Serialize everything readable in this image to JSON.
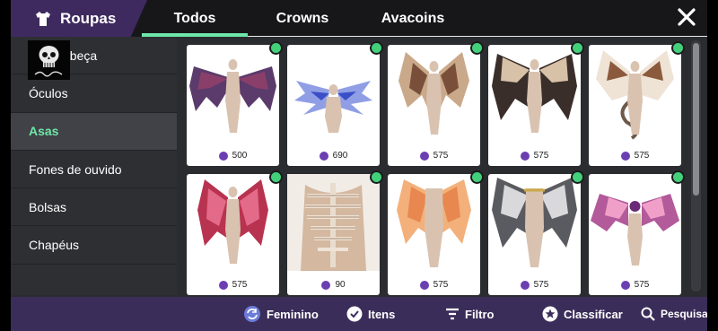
{
  "header": {
    "title": "Roupas",
    "tabs": [
      {
        "label": "Todos",
        "active": true
      },
      {
        "label": "Crowns",
        "active": false
      },
      {
        "label": "Avacoins",
        "active": false
      }
    ]
  },
  "sidebar": {
    "items": [
      {
        "label": "abeça"
      },
      {
        "label": "Óculos"
      },
      {
        "label": "Asas",
        "active": true
      },
      {
        "label": "Fones de ouvido"
      },
      {
        "label": "Bolsas"
      },
      {
        "label": "Chapéus"
      },
      {
        "label": ""
      }
    ]
  },
  "items": [
    {
      "price": "500",
      "owned": true
    },
    {
      "price": "690",
      "owned": true
    },
    {
      "price": "575",
      "owned": true
    },
    {
      "price": "575",
      "owned": true
    },
    {
      "price": "575",
      "owned": true
    },
    {
      "price": "575",
      "owned": true
    },
    {
      "price": "90",
      "owned": true
    },
    {
      "price": "575",
      "owned": true
    },
    {
      "price": "575",
      "owned": true
    },
    {
      "price": "575",
      "owned": true
    }
  ],
  "bottombar": {
    "feminino": "Feminino",
    "itens": "Itens",
    "filtro": "Filtro",
    "classificar": "Classificar",
    "pesquisa": "Pesquisa"
  },
  "colors": {
    "accent": "#6ee7a8",
    "brand": "#3e2a5e",
    "bottom": "#3b2d59",
    "coin": "#6b3fb2"
  }
}
